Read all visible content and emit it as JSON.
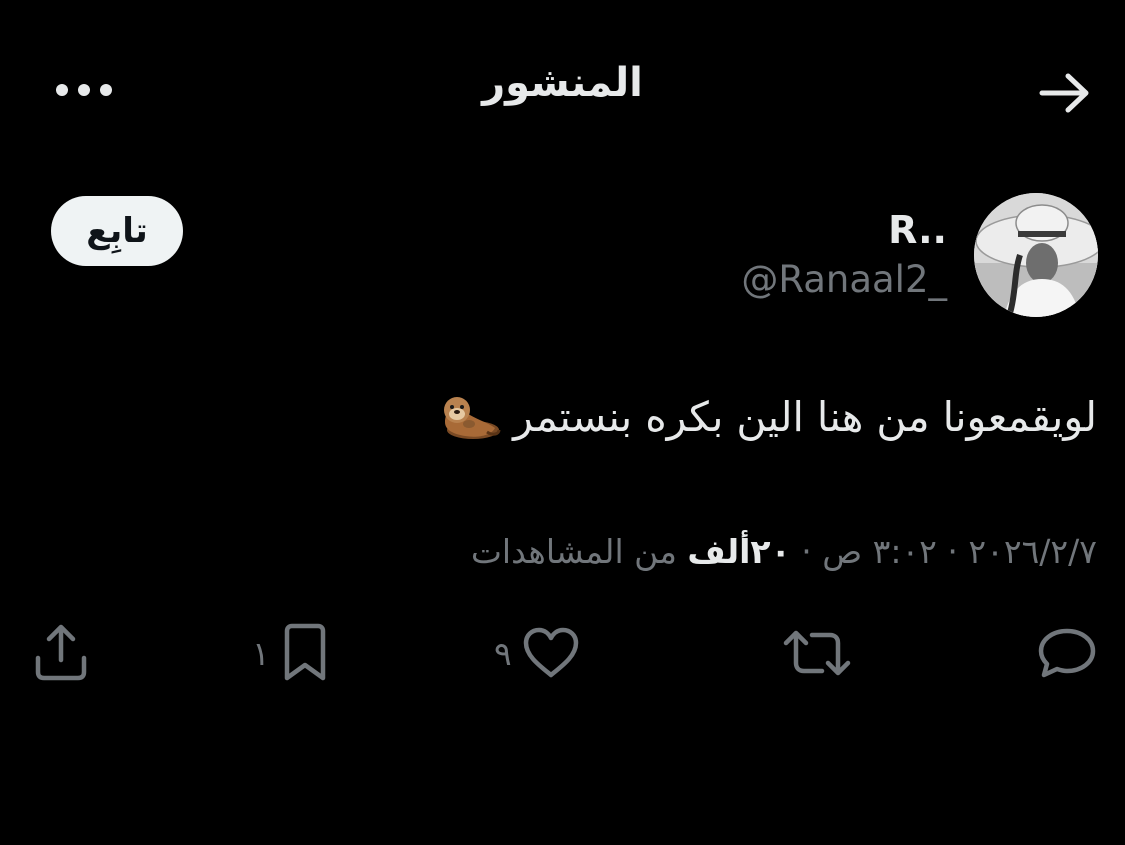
{
  "header": {
    "title": "المنشور",
    "back_icon": "arrow-right-icon",
    "more_icon": "more-horizontal-icon"
  },
  "author": {
    "display_name": "R..",
    "handle": "@Ranaal2_",
    "avatar": "avatar-photo-woman-with-hat",
    "follow_label": "تابِع"
  },
  "post": {
    "text": "لويقمعونا من هنا الين بكره بنستمر",
    "emoji": "otter-emoji"
  },
  "meta": {
    "date": "٢٠٢٦/٢/٧",
    "separator": "·",
    "time": "٣:٠٢ ص",
    "views_count": "٢٠ألف",
    "views_label": "من المشاهدات"
  },
  "actions": {
    "reply": {
      "icon": "reply-icon"
    },
    "repost": {
      "icon": "repost-icon"
    },
    "like": {
      "icon": "heart-icon",
      "count": "٩"
    },
    "bookmark": {
      "icon": "bookmark-icon",
      "count": "١"
    },
    "share": {
      "icon": "share-icon"
    }
  },
  "colors": {
    "background": "#000000",
    "text_primary": "#e7e9ea",
    "text_secondary": "#71767b",
    "follow_button_bg": "#eff3f4",
    "follow_button_text": "#0f1419"
  }
}
